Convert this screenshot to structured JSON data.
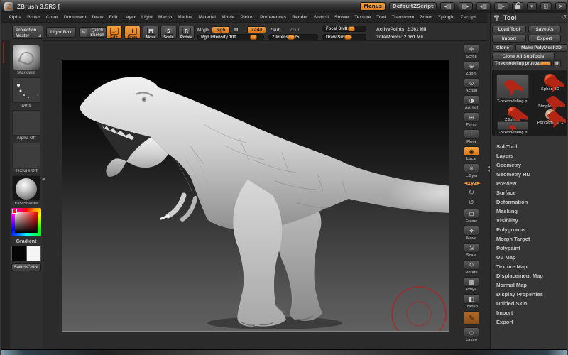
{
  "accent_color": "#ef8f2e",
  "titlebar": {
    "logo": "Z",
    "title": "ZBrush 3.5R3 [",
    "menus_button": "Menus",
    "zscript_button": "DefaultZScript",
    "window_buttons": {
      "dock1": "◂▤",
      "dock2": "▤▸",
      "dock3": "◂▥",
      "dock4": "▥▸",
      "restore": "▾",
      "maximize": "◱",
      "close": "×"
    }
  },
  "menu_bar": {
    "items": [
      "Alpha",
      "Brush",
      "Color",
      "Document",
      "Draw",
      "Edit",
      "Layer",
      "Light",
      "Macro",
      "Marker",
      "Material",
      "Movie",
      "Picker",
      "Preferences",
      "Render",
      "Stencil",
      "Stroke",
      "Texture",
      "Tool",
      "Transform",
      "Zoom",
      "Zplugin",
      "Zscript"
    ]
  },
  "toolbar": {
    "projection_master": "Projection Master",
    "light_box": "Light Box",
    "quick_sketch": "Quick Sketch",
    "edit": "Edit",
    "draw": "Draw",
    "move": "Move",
    "scale": "Scale",
    "rotate": "Rotate",
    "mrgb": "Mrgb",
    "rgb": "Rgb",
    "m": "M",
    "zadd": "Zadd",
    "zsub": "Zsub",
    "zcut": "Zcut",
    "sliders": {
      "rgb_intensity": {
        "label": "Rgb Intensity 100",
        "pct": 86
      },
      "z_intensity": {
        "label": "Z Intensity 25",
        "pct": 47
      },
      "focal_shift": {
        "label": "Focal Shift 0",
        "pct": 68
      },
      "draw_size": {
        "label": "Draw Size 64",
        "pct": 60
      }
    },
    "active_points": "ActivePoints: 2.361 Mil",
    "total_points": "TotalPoints: 2.361 Mil"
  },
  "left_tray": {
    "items": [
      {
        "name": "standard-brush",
        "label": "Standard",
        "kind": "brush"
      },
      {
        "name": "stroke-dots",
        "label": "Dots",
        "kind": "dots"
      },
      {
        "name": "alpha-off",
        "label": "Alpha  Off",
        "kind": "empty"
      },
      {
        "name": "texture-off",
        "label": "Texture  Off",
        "kind": "empty"
      },
      {
        "name": "material",
        "label": "FastShader",
        "kind": "matcap"
      }
    ],
    "gradient_label": "Gradient",
    "switch_color": "SwitchColor"
  },
  "right_shelf": {
    "items": [
      {
        "name": "scroll",
        "label": "Scroll",
        "glyph": "✛"
      },
      {
        "name": "zoom",
        "label": "Zoom",
        "glyph": "⊕"
      },
      {
        "name": "actual",
        "label": "Actual",
        "glyph": "⊙"
      },
      {
        "name": "aahalf",
        "label": "AAHalf",
        "glyph": "◑"
      },
      {
        "name": "persp",
        "label": "Persp",
        "glyph": "⊞"
      },
      {
        "name": "floor",
        "label": "Floor",
        "glyph": "⊥"
      },
      {
        "name": "local",
        "label": "Local",
        "glyph": "◉",
        "active": true
      },
      {
        "name": "lsym",
        "label": "L.Sym",
        "glyph": "✳"
      },
      {
        "name": "xyz-axis",
        "label": "",
        "glyph": "◄xyz►",
        "kind": "text",
        "active": true
      },
      {
        "name": "spin-cw",
        "label": "",
        "glyph": "↻",
        "kind": "bare"
      },
      {
        "name": "spin-ccw",
        "label": "",
        "glyph": "↺",
        "kind": "bare"
      },
      {
        "name": "frame",
        "label": "Frame",
        "glyph": "⊡"
      },
      {
        "name": "move3d",
        "label": "Move",
        "glyph": "❖"
      },
      {
        "name": "scale3d",
        "label": "Scale",
        "glyph": "⇲"
      },
      {
        "name": "rotate3d",
        "label": "Rotate",
        "glyph": "↻"
      },
      {
        "name": "polyf",
        "label": "PolyF",
        "glyph": "▦"
      },
      {
        "name": "transp",
        "label": "Transp",
        "glyph": "◧"
      },
      {
        "name": "ghost",
        "label": "",
        "glyph": "✎",
        "kind": "big",
        "active": true
      },
      {
        "name": "lasso",
        "label": "Lasso",
        "glyph": "◌"
      }
    ]
  },
  "tool_panel": {
    "header": "Tool",
    "refresh_icon": "↺",
    "btn_load": "Load Tool",
    "btn_save": "Save As",
    "btn_import": "Import",
    "btn_export": "Export",
    "btn_clone": "Clone",
    "btn_makepoly": "Make PolyMesh3D",
    "btn_cloneall": "Clone  All  SubTools",
    "active_tool_label": "T-rexmodeling prueba",
    "r_button": "R",
    "palette_items": [
      {
        "name": "trex-active",
        "label": "T-rexmodeling p.",
        "kind": "trex-big"
      },
      {
        "name": "sphere3d",
        "label": "Sphere3D",
        "kind": "sphere-red"
      },
      {
        "name": "simplebrush",
        "label": "SimpleBrush",
        "kind": "s-brush",
        "glyph": "S"
      },
      {
        "name": "zsphere",
        "label": "ZSphere",
        "kind": "sphere-red2"
      },
      {
        "name": "polysphere",
        "label": "PolySphere_1",
        "kind": "sphere-tan"
      },
      {
        "name": "trex-recent",
        "label": "T-rexmodeling p.",
        "kind": "trex-small"
      }
    ],
    "sections": [
      "SubTool",
      "Layers",
      "Geometry",
      "Geometry HD",
      "Preview",
      "Surface",
      "Deformation",
      "Masking",
      "Visibility",
      "Polygroups",
      "Morph Target",
      "Polypaint",
      "UV Map",
      "Texture Map",
      "Displacement Map",
      "Normal Map",
      "Display Properties",
      "Unified Skin",
      "Import",
      "Export"
    ]
  },
  "canvas": {
    "cursor_color": "#b32020"
  }
}
